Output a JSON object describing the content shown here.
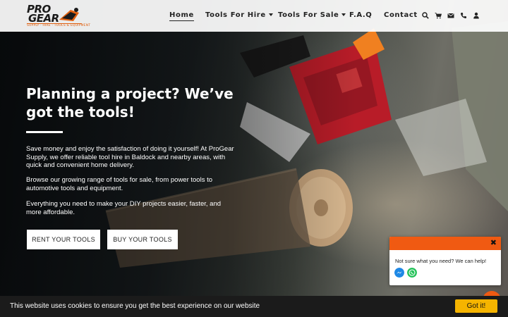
{
  "header": {
    "logo": {
      "line1": "PRO",
      "line2": "GEAR",
      "tagline": "SUPPLY · HIRE · TOOLS & EQUIPMENT"
    },
    "nav": [
      {
        "label": "Home",
        "active": true,
        "dropdown": false
      },
      {
        "label": "Tools For Hire",
        "active": false,
        "dropdown": true
      },
      {
        "label": "Tools For Sale",
        "active": false,
        "dropdown": true
      },
      {
        "label": "F.A.Q",
        "active": false,
        "dropdown": false
      },
      {
        "label": "Contact",
        "active": false,
        "dropdown": false
      }
    ],
    "icons": [
      "search-icon",
      "cart-icon",
      "envelope-icon",
      "phone-icon",
      "user-icon"
    ]
  },
  "hero": {
    "title": "Planning a project? We’ve got the tools!",
    "paragraphs": [
      "Save money and enjoy the satisfaction of doing it yourself! At ProGear Supply, we offer reliable tool hire in Baldock and nearby areas, with quick and convenient home delivery.",
      "Browse our growing range of tools for sale, from power tools to automotive tools and equipment.",
      "Everything you need to make your DIY projects easier, faster, and more affordable."
    ],
    "buttons": {
      "rent": "RENT YOUR TOOLS",
      "buy": "BUY YOUR TOOLS"
    }
  },
  "chat": {
    "message": "Not sure what you need? We can help!",
    "close": "✖",
    "icons": [
      "messenger-icon",
      "whatsapp-icon"
    ]
  },
  "cookie": {
    "message": "This website uses cookies to ensure you get the best experience on our website",
    "button": "Got it!"
  },
  "colors": {
    "accent": "#f05a12",
    "cookie_button": "#f5b400",
    "header_bg": "#ffffff",
    "cookie_bg": "#1b1b1b"
  }
}
